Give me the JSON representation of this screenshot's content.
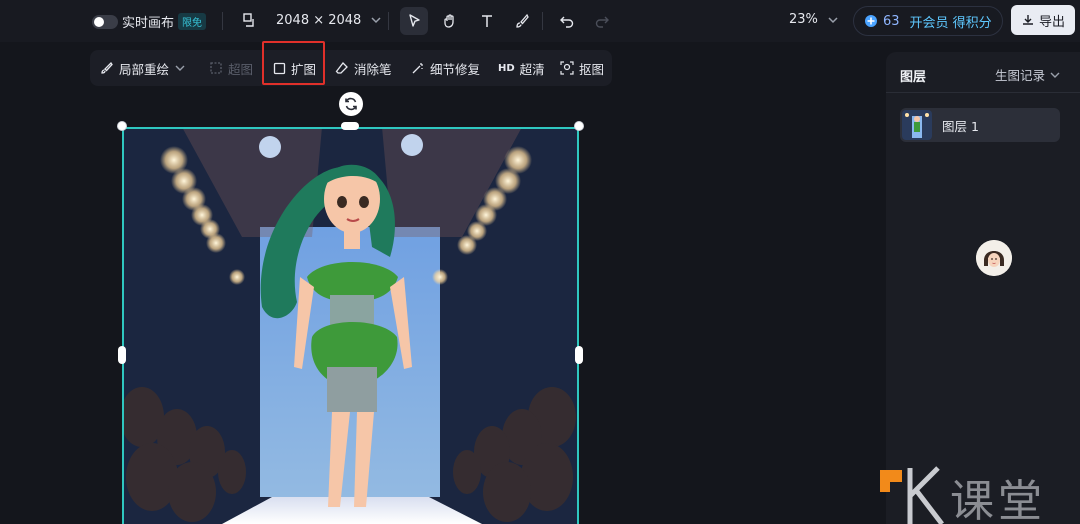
{
  "topbar": {
    "realtime_canvas_label": "实时画布",
    "free_badge": "限免",
    "canvas_size": "2048 × 2048",
    "zoom": "23%",
    "points": "63",
    "vip_label": "开会员 得积分",
    "export_label": "导出"
  },
  "toolbar2": {
    "local_redraw": "局部重绘",
    "erase_disabled": "超图",
    "expand": "扩图",
    "eraser_brush": "消除笔",
    "detail_repair": "细节修复",
    "hd_prefix": "HD",
    "super_clear": "超清",
    "cutout": "抠图"
  },
  "right_panel": {
    "title": "图层",
    "history": "生图记录",
    "layers": [
      {
        "label": "图层 1"
      }
    ]
  },
  "icons": {
    "select_tool": "cursor-icon",
    "hand_tool": "hand-icon",
    "text_tool": "text-icon",
    "brush_tool": "brush-icon",
    "undo": "undo-icon",
    "redo": "redo-icon"
  },
  "colors": {
    "accent_teal": "#2fc7c0",
    "highlight_red": "#e0302a",
    "vip_blue": "#5ec8ff"
  }
}
